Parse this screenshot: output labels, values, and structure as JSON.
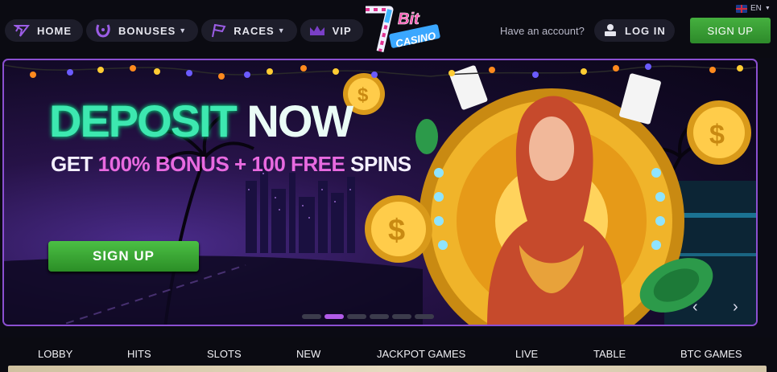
{
  "header": {
    "nav": [
      {
        "label": "HOME",
        "icon": "home-claw-icon",
        "has_dropdown": false
      },
      {
        "label": "BONUSES",
        "icon": "horseshoe-icon",
        "has_dropdown": true
      },
      {
        "label": "RACES",
        "icon": "race-flag-icon",
        "has_dropdown": true
      },
      {
        "label": "VIP",
        "icon": "crown-icon",
        "has_dropdown": false
      }
    ],
    "logo_alt": "7 Bit Casino",
    "logo_text_bit": "Bit",
    "logo_text_casino": "CASINO",
    "language": "EN",
    "have_account": "Have an account?",
    "login_label": "LOG IN",
    "signup_label": "SIGN UP"
  },
  "banner": {
    "headline_part1": "DEPOSIT",
    "headline_part2": " NOW",
    "sub_part1": "GET ",
    "sub_part2": "100% BONUS + 100 FREE",
    "sub_part3": " SPINS",
    "cta_label": "SIGN UP",
    "slide_count": 6,
    "active_slide": 2,
    "prev_arrow": "‹",
    "next_arrow": "›"
  },
  "categories": [
    "LOBBY",
    "HITS",
    "SLOTS",
    "NEW",
    "JACKPOT GAMES",
    "LIVE",
    "TABLE",
    "BTC GAMES"
  ],
  "colors": {
    "accent_purple": "#8b4fd1",
    "signup_green": "#3aa536",
    "headline_teal": "#3de8b0",
    "sub_pink": "#e86ae0"
  }
}
